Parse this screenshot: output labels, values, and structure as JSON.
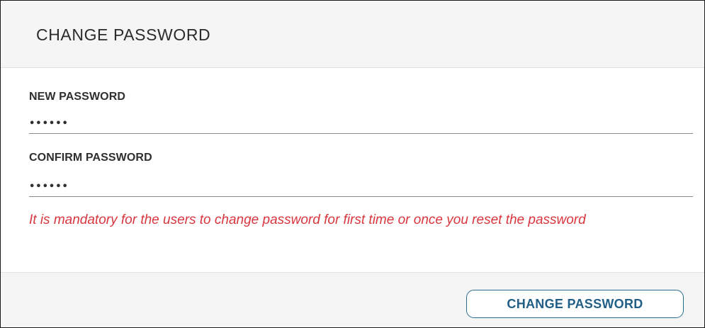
{
  "header": {
    "title": "CHANGE PASSWORD"
  },
  "form": {
    "new_password": {
      "label": "NEW PASSWORD",
      "value": "••••••"
    },
    "confirm_password": {
      "label": "CONFIRM PASSWORD",
      "value": "••••••"
    },
    "notice": "It is mandatory for the users to change password for first time or once you reset the password"
  },
  "footer": {
    "submit_label": "CHANGE PASSWORD"
  },
  "colors": {
    "notice": "#d9363e",
    "button_border": "#2a6b8f",
    "button_text": "#215f86",
    "header_background": "#f5f5f5"
  }
}
